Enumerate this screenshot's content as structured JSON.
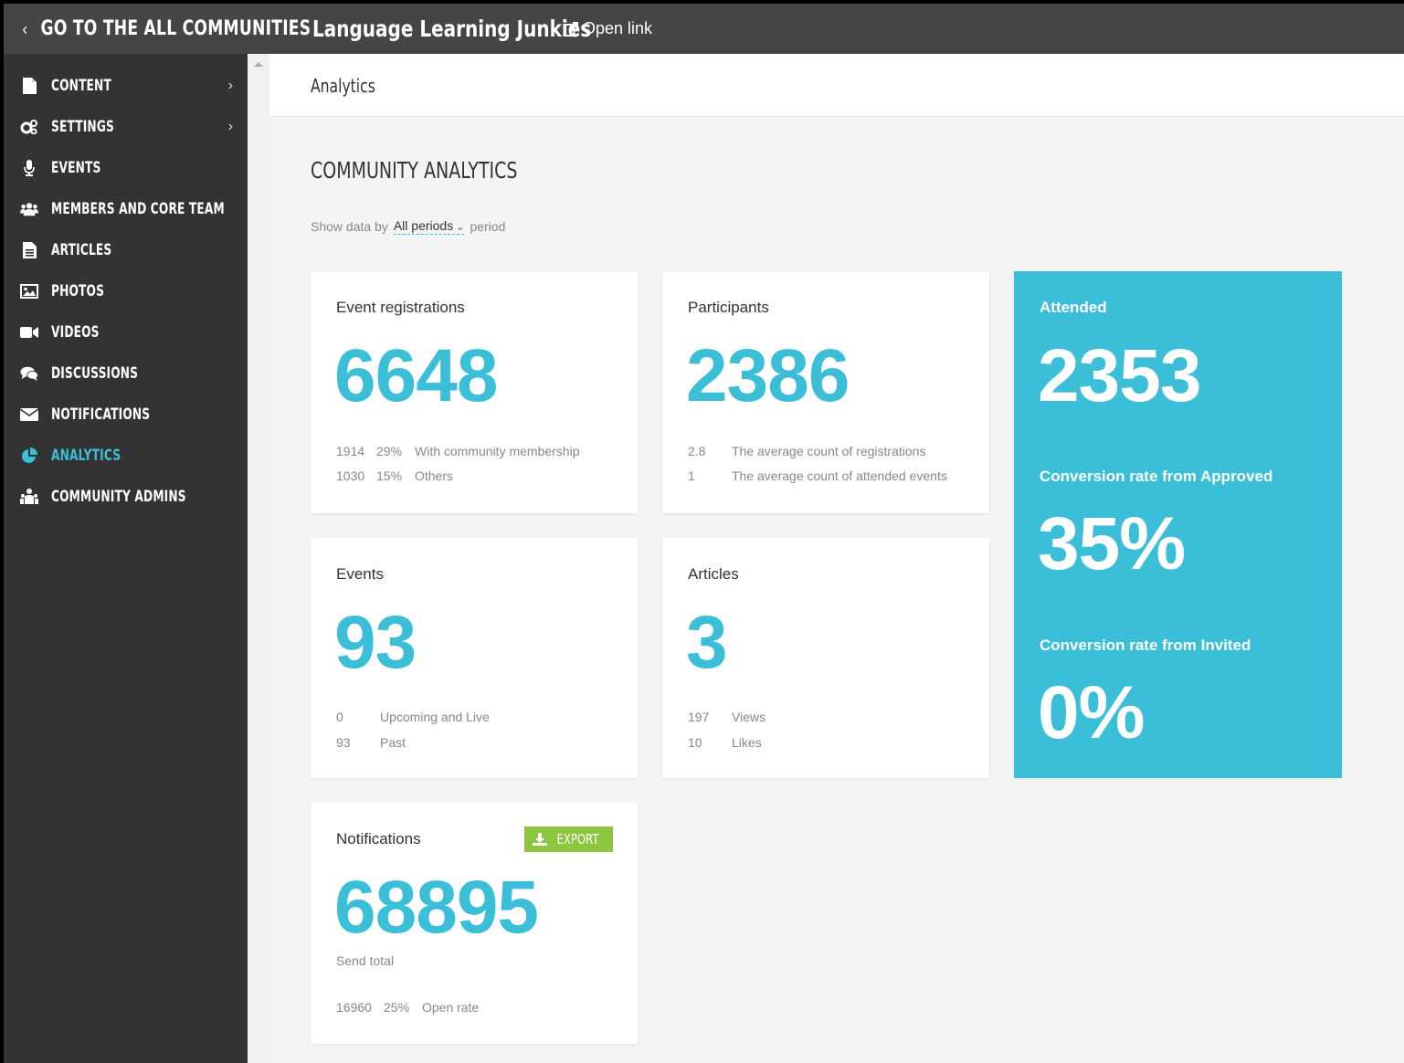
{
  "topbar": {
    "back_label": "GO TO THE ALL COMMUNITIES",
    "community_name": "Language Learning Junkies",
    "open_link": "Open link"
  },
  "sidebar": {
    "items": [
      {
        "label": "CONTENT",
        "icon": "file-icon",
        "arrow": true
      },
      {
        "label": "SETTINGS",
        "icon": "gears-icon",
        "arrow": true
      },
      {
        "label": "EVENTS",
        "icon": "microphone-icon",
        "arrow": false
      },
      {
        "label": "MEMBERS AND CORE TEAM",
        "icon": "users-icon",
        "arrow": false
      },
      {
        "label": "ARTICLES",
        "icon": "document-icon",
        "arrow": false
      },
      {
        "label": "PHOTOS",
        "icon": "image-icon",
        "arrow": false
      },
      {
        "label": "VIDEOS",
        "icon": "video-camera-icon",
        "arrow": false
      },
      {
        "label": "DISCUSSIONS",
        "icon": "comments-icon",
        "arrow": false
      },
      {
        "label": "NOTIFICATIONS",
        "icon": "envelope-icon",
        "arrow": false
      },
      {
        "label": "ANALYTICS",
        "icon": "pie-chart-icon",
        "arrow": false,
        "active": true
      },
      {
        "label": "COMMUNITY ADMINS",
        "icon": "sitemap-icon",
        "arrow": false
      }
    ]
  },
  "header": {
    "breadcrumb": "Analytics"
  },
  "main": {
    "title": "COMMUNITY ANALYTICS",
    "filter": {
      "prefix": "Show data by",
      "value": "All periods",
      "suffix": "period"
    }
  },
  "cards": {
    "registrations": {
      "title": "Event registrations",
      "value": "6648",
      "rows": [
        {
          "count": "1914",
          "pct": "29%",
          "label": "With community membership"
        },
        {
          "count": "1030",
          "pct": "15%",
          "label": "Others"
        }
      ]
    },
    "participants": {
      "title": "Participants",
      "value": "2386",
      "rows": [
        {
          "count": "2.8",
          "label": "The average count of registrations"
        },
        {
          "count": "1",
          "label": "The average count of attended events"
        }
      ]
    },
    "attended": {
      "title": "Attended",
      "value": "2353",
      "approved_label": "Conversion rate from Approved",
      "approved_value": "35%",
      "invited_label": "Conversion rate from Invited",
      "invited_value": "0%"
    },
    "events": {
      "title": "Events",
      "value": "93",
      "rows": [
        {
          "count": "0",
          "label": "Upcoming and Live"
        },
        {
          "count": "93",
          "label": "Past"
        }
      ]
    },
    "articles": {
      "title": "Articles",
      "value": "3",
      "rows": [
        {
          "count": "197",
          "label": "Views"
        },
        {
          "count": "10",
          "label": "Likes"
        }
      ]
    },
    "notifications": {
      "title": "Notifications",
      "export_label": "EXPORT",
      "value": "68895",
      "sub": "Send total",
      "row": {
        "count": "16960",
        "pct": "25%",
        "label": "Open rate"
      }
    }
  },
  "colors": {
    "accent": "#3bbfd8",
    "export": "#8cc63e",
    "sidebar": "#333333",
    "topbar": "#454545"
  }
}
